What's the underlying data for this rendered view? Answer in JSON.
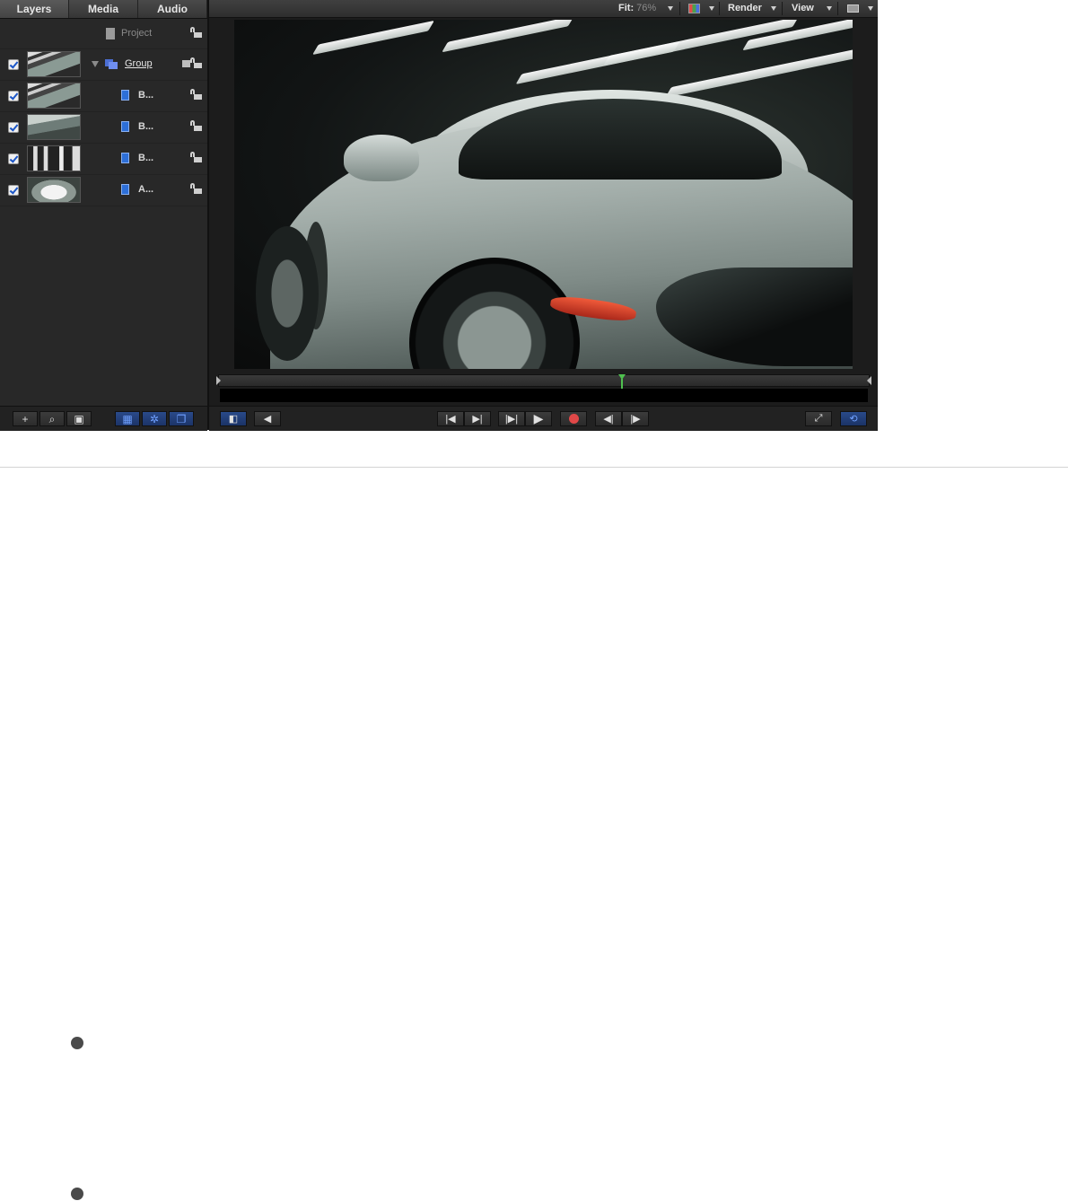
{
  "tabs": [
    {
      "label": "Layers"
    },
    {
      "label": "Media"
    },
    {
      "label": "Audio"
    }
  ],
  "layers": {
    "project_label": "Project",
    "group_label": "Group",
    "children": [
      {
        "label": "B..."
      },
      {
        "label": "B..."
      },
      {
        "label": "B..."
      },
      {
        "label": "A..."
      }
    ]
  },
  "topbar": {
    "fit_label": "Fit:",
    "fit_value": "76%",
    "render_label": "Render",
    "view_label": "View"
  },
  "timeline": {
    "playhead_fraction": 0.62
  },
  "icons": {
    "left_toolbar": [
      "add-icon",
      "search-icon",
      "media-import-icon",
      "grid-icon",
      "gear-icon",
      "layers-icon"
    ],
    "transport": [
      "panel-toggle-icon",
      "audio-icon",
      "go-to-start-icon",
      "go-to-end-icon",
      "step-end-icon",
      "play-icon",
      "record-icon",
      "prev-frame-icon",
      "next-frame-icon",
      "fullscreen-icon",
      "loop-icon"
    ]
  },
  "colors": {
    "accent_blue": "#2d6fd8",
    "playhead_green": "#4fc14f",
    "record_red": "#e04848"
  }
}
